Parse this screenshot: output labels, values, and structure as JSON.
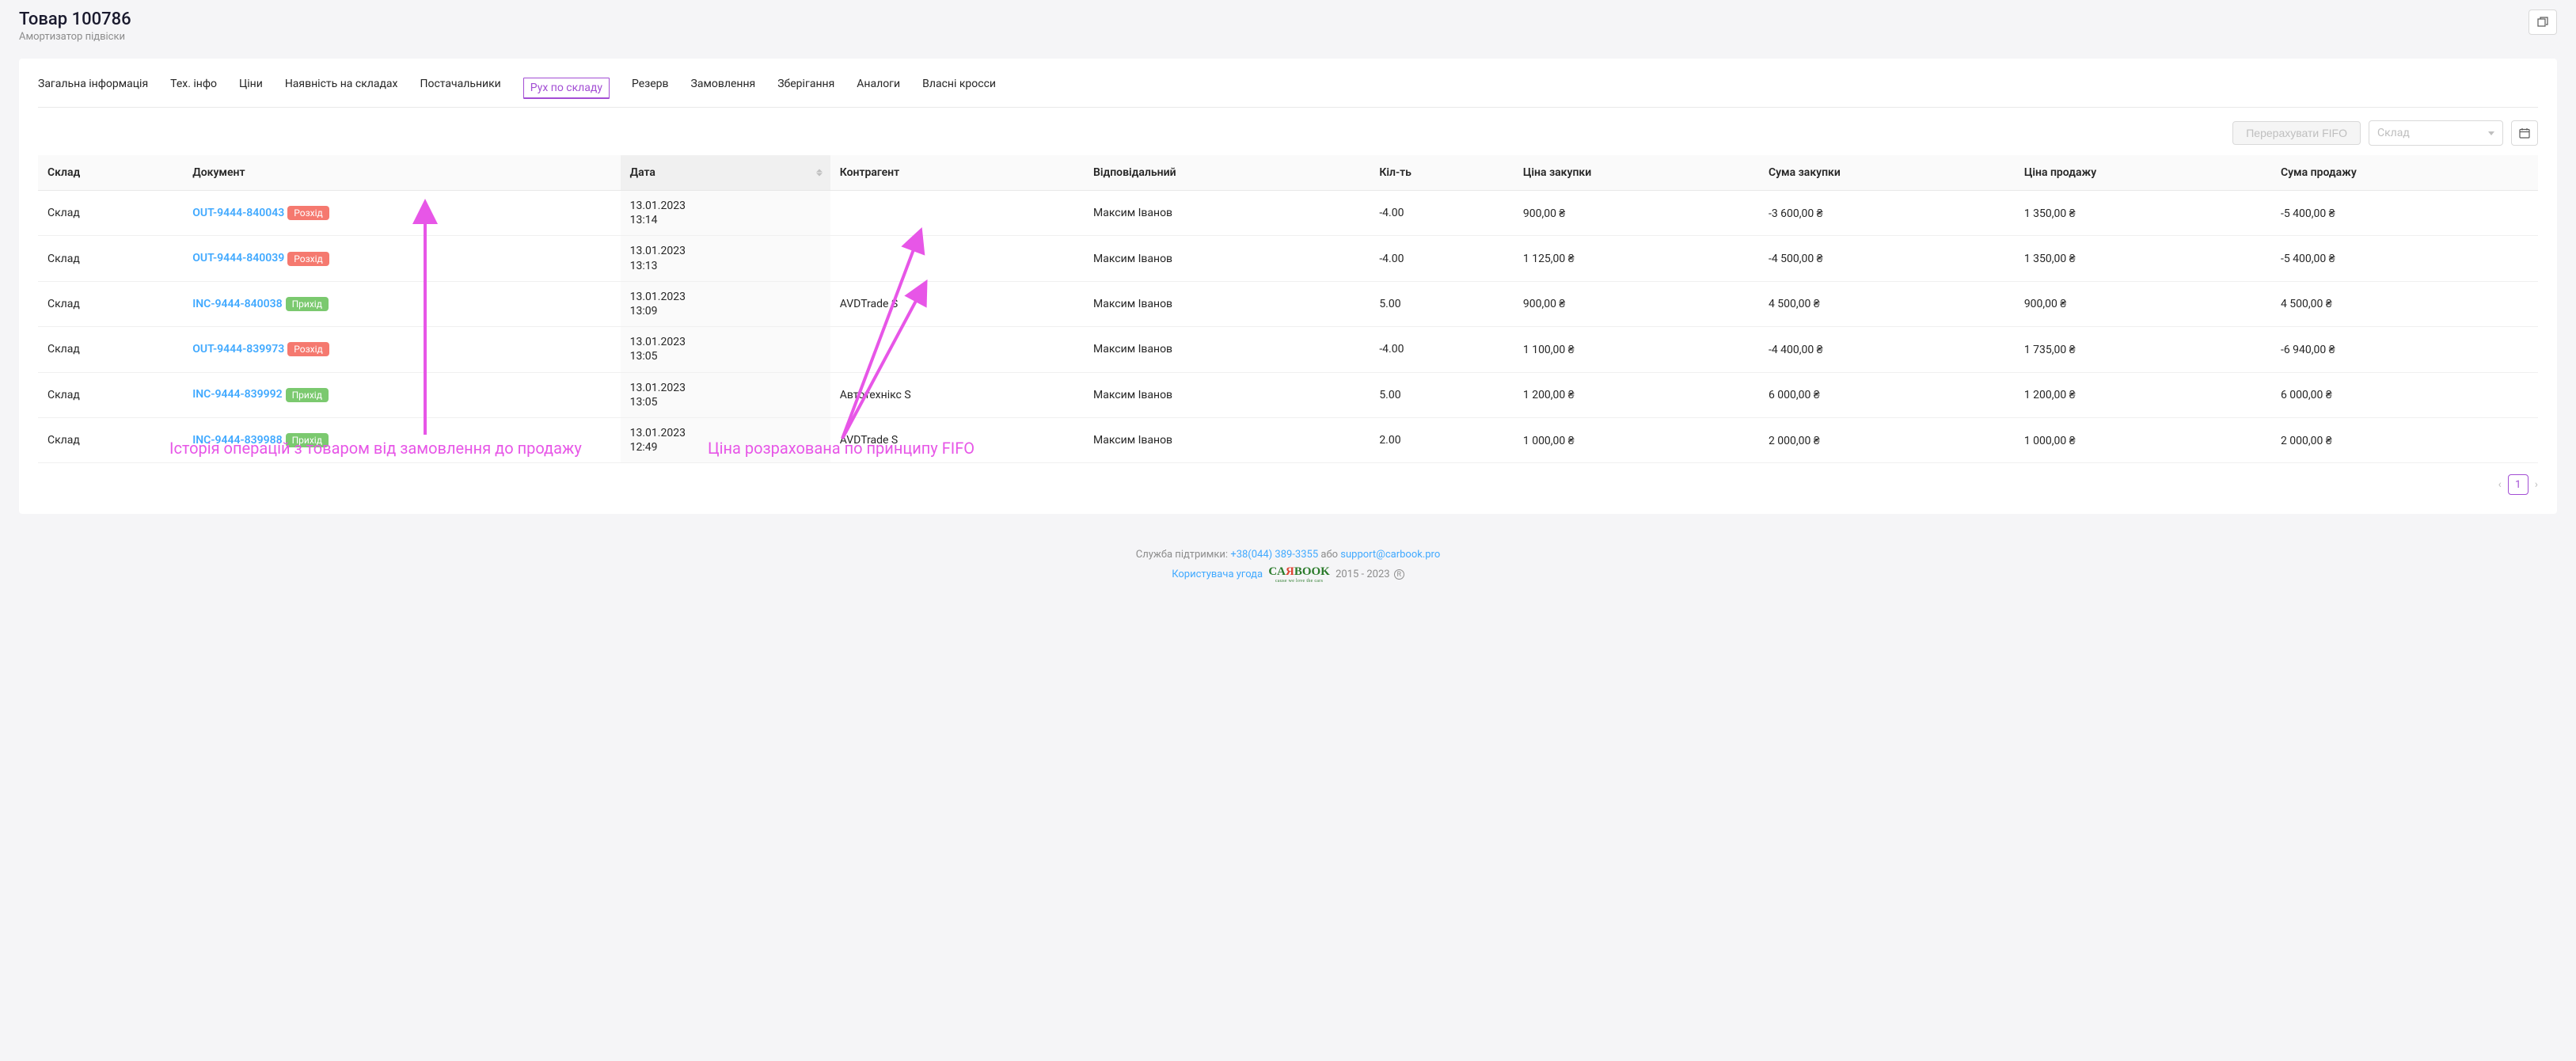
{
  "header": {
    "title": "Товар 100786",
    "subtitle": "Амортизатор підвіски"
  },
  "tabs": [
    {
      "label": "Загальна інформація",
      "active": false
    },
    {
      "label": "Тех. інфо",
      "active": false
    },
    {
      "label": "Ціни",
      "active": false
    },
    {
      "label": "Наявність на складах",
      "active": false
    },
    {
      "label": "Постачальники",
      "active": false
    },
    {
      "label": "Рух по складу",
      "active": true
    },
    {
      "label": "Резерв",
      "active": false
    },
    {
      "label": "Замовлення",
      "active": false
    },
    {
      "label": "Зберігання",
      "active": false
    },
    {
      "label": "Аналоги",
      "active": false
    },
    {
      "label": "Власні кросси",
      "active": false
    }
  ],
  "controls": {
    "recalc_label": "Перерахувати FIFO",
    "warehouse_placeholder": "Склад"
  },
  "columns": {
    "warehouse": "Склад",
    "document": "Документ",
    "date": "Дата",
    "counterparty": "Контрагент",
    "responsible": "Відповідальний",
    "qty": "Кіл-ть",
    "purchase_price": "Ціна закупки",
    "purchase_sum": "Сума закупки",
    "sale_price": "Ціна продажу",
    "sale_sum": "Сума продажу"
  },
  "tag_labels": {
    "out": "Розхід",
    "in": "Прихід"
  },
  "rows": [
    {
      "warehouse": "Склад",
      "doc": "OUT-9444-840043",
      "dir": "out",
      "date": "13.01.2023",
      "time": "13:14",
      "counterparty": "",
      "responsible": "Максим Іванов",
      "qty": "-4.00",
      "pprice": "900,00 ₴",
      "psum": "-3 600,00 ₴",
      "sprice": "1 350,00 ₴",
      "ssum": "-5 400,00 ₴"
    },
    {
      "warehouse": "Склад",
      "doc": "OUT-9444-840039",
      "dir": "out",
      "date": "13.01.2023",
      "time": "13:13",
      "counterparty": "",
      "responsible": "Максим Іванов",
      "qty": "-4.00",
      "pprice": "1 125,00 ₴",
      "psum": "-4 500,00 ₴",
      "sprice": "1 350,00 ₴",
      "ssum": "-5 400,00 ₴"
    },
    {
      "warehouse": "Склад",
      "doc": "INC-9444-840038",
      "dir": "in",
      "date": "13.01.2023",
      "time": "13:09",
      "counterparty": "AVDTrade S",
      "responsible": "Максим Іванов",
      "qty": "5.00",
      "pprice": "900,00 ₴",
      "psum": "4 500,00 ₴",
      "sprice": "900,00 ₴",
      "ssum": "4 500,00 ₴"
    },
    {
      "warehouse": "Склад",
      "doc": "OUT-9444-839973",
      "dir": "out",
      "date": "13.01.2023",
      "time": "13:05",
      "counterparty": "",
      "responsible": "Максим Іванов",
      "qty": "-4.00",
      "pprice": "1 100,00 ₴",
      "psum": "-4 400,00 ₴",
      "sprice": "1 735,00 ₴",
      "ssum": "-6 940,00 ₴"
    },
    {
      "warehouse": "Склад",
      "doc": "INC-9444-839992",
      "dir": "in",
      "date": "13.01.2023",
      "time": "13:05",
      "counterparty": "Автотехнікс S",
      "responsible": "Максим Іванов",
      "qty": "5.00",
      "pprice": "1 200,00 ₴",
      "psum": "6 000,00 ₴",
      "sprice": "1 200,00 ₴",
      "ssum": "6 000,00 ₴"
    },
    {
      "warehouse": "Склад",
      "doc": "INC-9444-839988",
      "dir": "in",
      "date": "13.01.2023",
      "time": "12:49",
      "counterparty": "AVDTrade S",
      "responsible": "Максим Іванов",
      "qty": "2.00",
      "pprice": "1 000,00 ₴",
      "psum": "2 000,00 ₴",
      "sprice": "1 000,00 ₴",
      "ssum": "2 000,00 ₴"
    }
  ],
  "annotations": {
    "left": "Історія операцій з товаром від замовлення до продажу",
    "right": "Ціна розрахована по принципу FIFO"
  },
  "pagination": {
    "page": "1"
  },
  "footer": {
    "support_label": "Служба підтримки: ",
    "phone": "+38(044) 389-3355",
    "or": " або ",
    "email": "support@carbook.pro",
    "agreement": "Користувача угода",
    "logo_main": "CA",
    "logo_red": "Я",
    "logo_rest": "BOOK",
    "logo_tag": "cause we love the cars",
    "years": " 2015 - 2023 ",
    "r": "R"
  }
}
